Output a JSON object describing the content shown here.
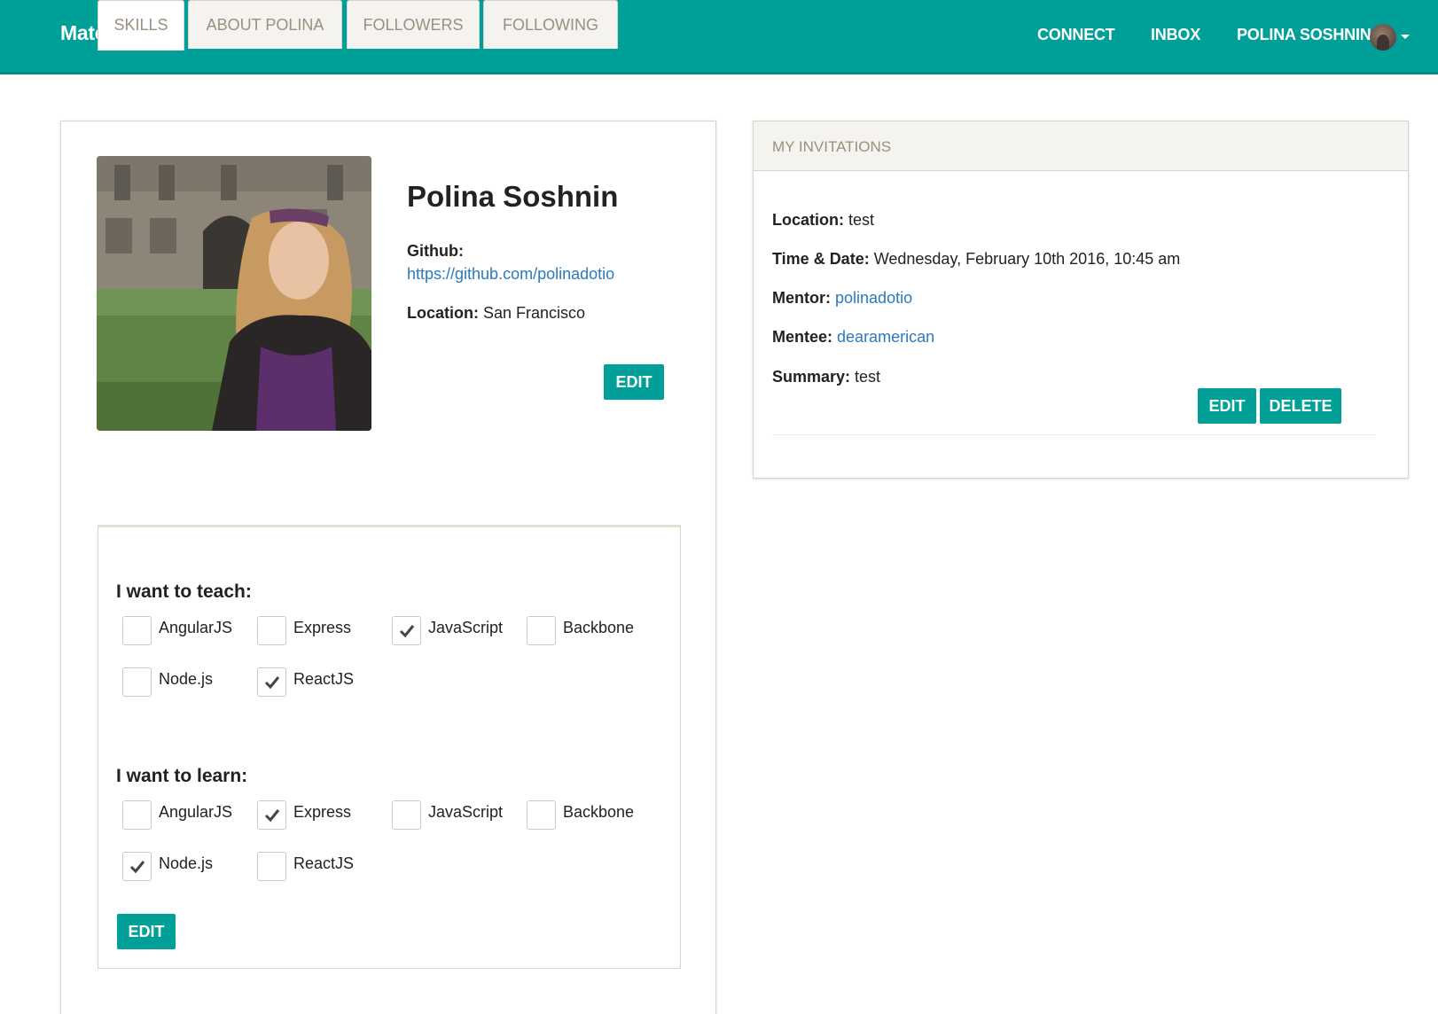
{
  "nav": {
    "brand": "MatchJS",
    "connect": "CONNECT",
    "inbox": "INBOX",
    "user": "POLINA SOSHNIN"
  },
  "profile": {
    "name": "Polina Soshnin",
    "github_label": "Github:",
    "github_url": "https://github.com/polinadotio",
    "location_label": "Location:",
    "location_value": "San Francisco",
    "edit_label": "EDIT"
  },
  "tabs": [
    {
      "label": "SKILLS",
      "active": true
    },
    {
      "label": "ABOUT POLINA",
      "active": false
    },
    {
      "label": "FOLLOWERS",
      "active": false
    },
    {
      "label": "FOLLOWING",
      "active": false
    }
  ],
  "skills": {
    "teach_heading": "I want to teach:",
    "teach": [
      {
        "label": "AngularJS",
        "checked": false
      },
      {
        "label": "Express",
        "checked": false
      },
      {
        "label": "JavaScript",
        "checked": true
      },
      {
        "label": "Backbone",
        "checked": false
      },
      {
        "label": "Node.js",
        "checked": false
      },
      {
        "label": "ReactJS",
        "checked": true
      }
    ],
    "learn_heading": "I want to learn:",
    "learn": [
      {
        "label": "AngularJS",
        "checked": false
      },
      {
        "label": "Express",
        "checked": true
      },
      {
        "label": "JavaScript",
        "checked": false
      },
      {
        "label": "Backbone",
        "checked": false
      },
      {
        "label": "Node.js",
        "checked": true
      },
      {
        "label": "ReactJS",
        "checked": false
      }
    ],
    "edit_label": "EDIT"
  },
  "invitations": {
    "title": "MY INVITATIONS",
    "location_label": "Location:",
    "location_value": "test",
    "time_label": "Time & Date:",
    "time_value": "Wednesday, February 10th 2016, 10:45 am",
    "mentor_label": "Mentor:",
    "mentor_value": "polinadotio",
    "mentee_label": "Mentee:",
    "mentee_value": "dearamerican",
    "summary_label": "Summary:",
    "summary_value": "test",
    "edit_label": "EDIT",
    "delete_label": "DELETE"
  },
  "colors": {
    "primary": "#00a099",
    "link": "#2a7ac0",
    "muted": "#99907f"
  }
}
